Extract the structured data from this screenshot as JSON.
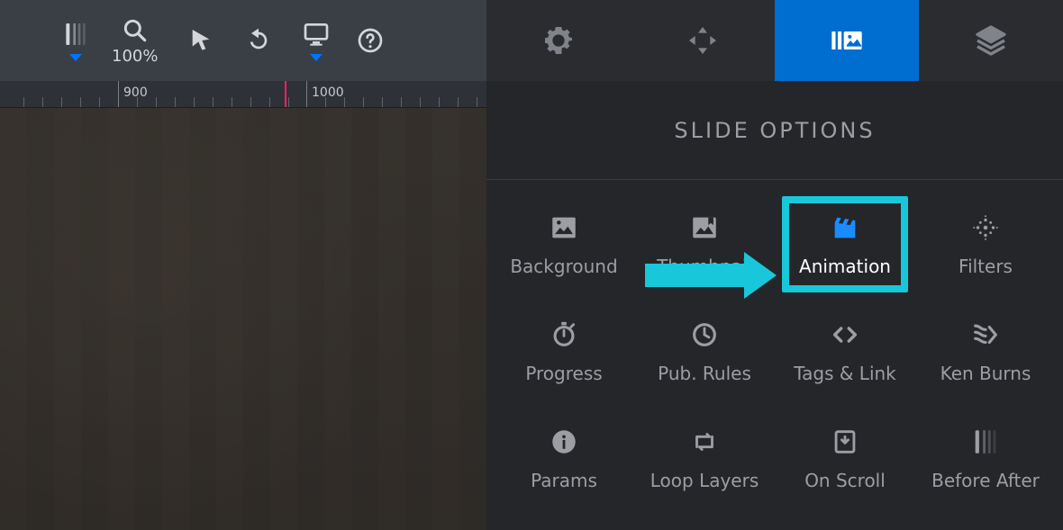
{
  "toolbar": {
    "zoom_label": "100%"
  },
  "ruler": {
    "marks": [
      "900",
      "1000"
    ]
  },
  "panel": {
    "title": "SLIDE OPTIONS"
  },
  "options": {
    "background": "Background",
    "thumbnail": "Thumbnail",
    "animation": "Animation",
    "filters": "Filters",
    "progress": "Progress",
    "pub_rules": "Pub. Rules",
    "tags_link": "Tags & Link",
    "ken_burns": "Ken Burns",
    "params": "Params",
    "loop_layers": "Loop Layers",
    "on_scroll": "On Scroll",
    "before_after": "Before After"
  }
}
